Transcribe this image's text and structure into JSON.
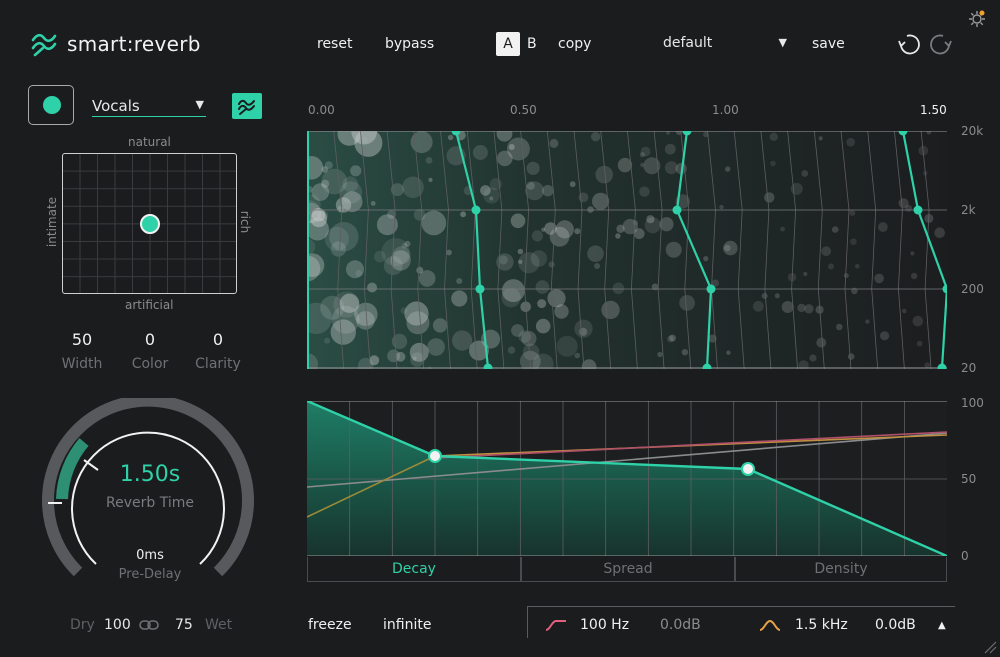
{
  "header": {
    "app_title": "smart:reverb",
    "reset_label": "reset",
    "bypass_label": "bypass",
    "ab_a": "A",
    "ab_b": "B",
    "copy_label": "copy",
    "preset_value": "default",
    "save_label": "save",
    "icons": [
      "logo-icon",
      "undo-icon",
      "redo-icon",
      "settings-icon"
    ]
  },
  "left": {
    "profile": "Vocals",
    "xy_pad": {
      "top": "natural",
      "bottom": "artificial",
      "left": "intimate",
      "right": "rich",
      "x_value": 0.5,
      "y_value": 0.5
    },
    "params": [
      {
        "label": "Width",
        "value": "50"
      },
      {
        "label": "Color",
        "value": "0"
      },
      {
        "label": "Clarity",
        "value": "0"
      }
    ],
    "reverb_time": {
      "value": "1.50s",
      "label": "Reverb Time"
    },
    "pre_delay": {
      "value": "0ms",
      "label": "Pre-Delay"
    },
    "dry_label": "Dry",
    "dry_value": "100",
    "wet_value": "75",
    "wet_label": "Wet"
  },
  "spectrogram": {
    "time_ticks": [
      "0.00",
      "0.50",
      "1.00",
      "1.50"
    ],
    "freq_ticks": [
      "20k",
      "2k",
      "200",
      "20"
    ]
  },
  "decay_graph": {
    "amount_ticks": [
      "100",
      "50",
      "0"
    ],
    "tabs": [
      "Decay",
      "Spread",
      "Density"
    ],
    "active_tab": "Decay"
  },
  "bottom": {
    "freeze_label": "freeze",
    "infinite_label": "infinite",
    "eq_low_freq": "100 Hz",
    "eq_low_gain": "0.0dB",
    "eq_high_freq": "1.5 kHz",
    "eq_high_gain": "0.0dB"
  },
  "colors": {
    "accent": "#2fd1a8",
    "background": "#1b1c1e",
    "low_cut": "#e0607e",
    "high_cut": "#e8a24a"
  }
}
